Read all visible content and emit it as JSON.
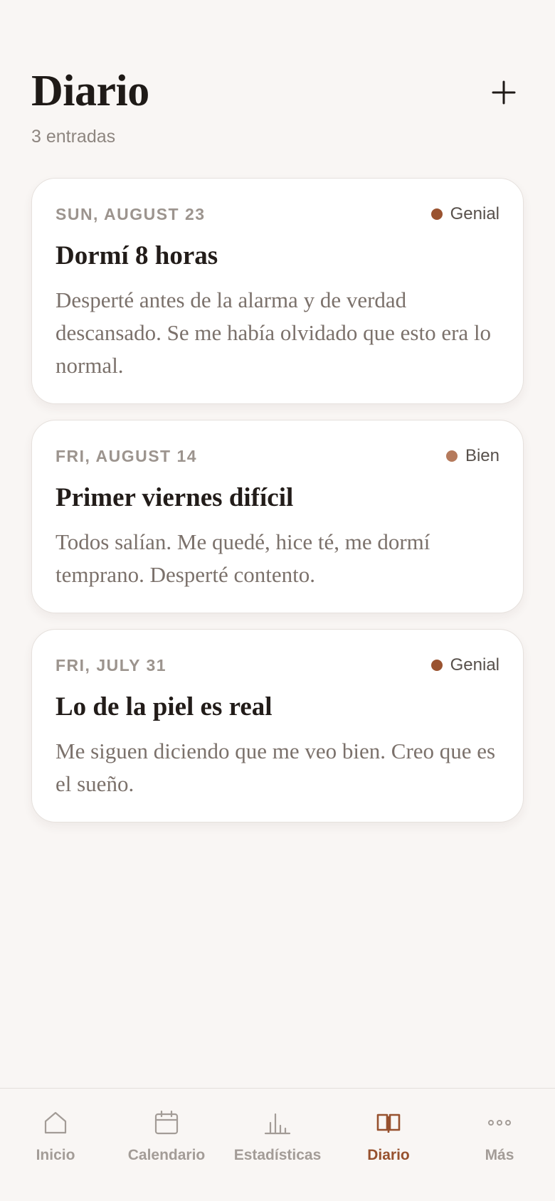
{
  "header": {
    "title": "Diario",
    "subtitle": "3 entradas",
    "add_icon": "plus-icon"
  },
  "entries": [
    {
      "date": "SUN, AUGUST 23",
      "mood": "Genial",
      "mood_color": "#9a5330",
      "title": "Dormí 8 horas",
      "body": "Desperté antes de la alarma y de verdad descansado. Se me había olvidado que esto era lo normal."
    },
    {
      "date": "FRI, AUGUST 14",
      "mood": "Bien",
      "mood_color": "#b57a5c",
      "title": "Primer viernes difícil",
      "body": "Todos salían. Me quedé, hice té, me dormí temprano. Desperté contento."
    },
    {
      "date": "FRI, JULY 31",
      "mood": "Genial",
      "mood_color": "#9a5330",
      "title": "Lo de la piel es real",
      "body": "Me siguen diciendo que me veo bien. Creo que es el sueño."
    }
  ],
  "tabbar": {
    "active_color": "#97512e",
    "inactive_color": "#a39c97",
    "tabs": [
      {
        "label": "Inicio",
        "icon": "home-icon"
      },
      {
        "label": "Calendario",
        "icon": "calendar-icon"
      },
      {
        "label": "Estadísticas",
        "icon": "bar-chart-icon"
      },
      {
        "label": "Diario",
        "icon": "open-book-icon",
        "active": true
      },
      {
        "label": "Más",
        "icon": "more-dots-icon"
      }
    ]
  }
}
